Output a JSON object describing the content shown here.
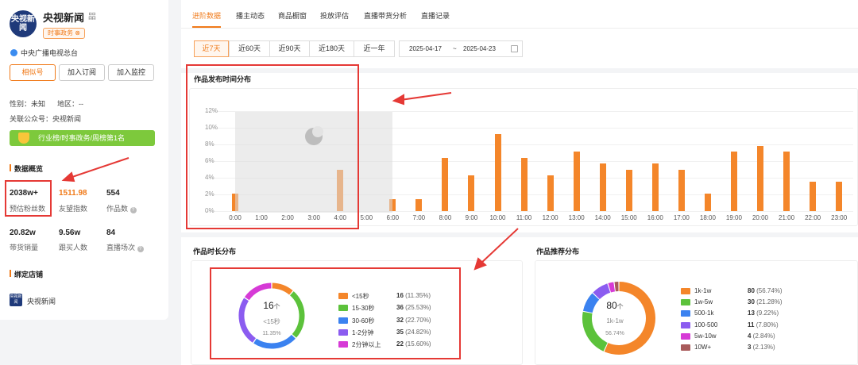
{
  "account": {
    "avatar_text": "央视新闻",
    "name": "央视新闻",
    "flag": "㗊",
    "tag": "时事政务 ⊗",
    "verified": "中央广播电视总台",
    "buttons": [
      "相似号",
      "加入订阅",
      "加入监控"
    ],
    "gender": "性别：未知",
    "region": "地区：--",
    "official": "关联公众号：央视新闻",
    "rank": "行业榜/时事政务/周榜第1名"
  },
  "overview": {
    "title": "数据概览",
    "stats": [
      {
        "value": "2038w+",
        "label": "预估粉丝数"
      },
      {
        "value": "1511.98",
        "label": "友望指数"
      },
      {
        "value": "554",
        "label": "作品数"
      },
      {
        "value": "20.82w",
        "label": "带货销量"
      },
      {
        "value": "9.56w",
        "label": "跟买人数"
      },
      {
        "value": "84",
        "label": "直播场次"
      }
    ]
  },
  "shop": {
    "title": "绑定店铺",
    "logo": "央视新闻",
    "name": "央视新闻"
  },
  "tabs": [
    "进阶数据",
    "播主动态",
    "商品橱窗",
    "投放评估",
    "直播带货分析",
    "直播记录"
  ],
  "ranges": [
    "近7天",
    "近60天",
    "近90天",
    "近180天",
    "近一年"
  ],
  "date_range": {
    "start": "2025-04-17",
    "sep": "~",
    "end": "2025-04-23"
  },
  "time_chart": {
    "title": "作品发布时间分布",
    "y_ticks": [
      "12%",
      "10%",
      "8%",
      "6%",
      "4%",
      "2%",
      "0%"
    ]
  },
  "duration_chart": {
    "title": "作品时长分布",
    "center_value": "16",
    "center_unit": "个",
    "center_label": "<15秒",
    "center_pct": "11.35%",
    "legend": [
      {
        "label": "<15秒",
        "count": "16",
        "pct": "(11.35%)",
        "color": "#f4862a"
      },
      {
        "label": "15-30秒",
        "count": "36",
        "pct": "(25.53%)",
        "color": "#5cc23b"
      },
      {
        "label": "30-60秒",
        "count": "32",
        "pct": "(22.70%)",
        "color": "#3b82f0"
      },
      {
        "label": "1-2分钟",
        "count": "35",
        "pct": "(24.82%)",
        "color": "#8b5cf0"
      },
      {
        "label": "2分钟以上",
        "count": "22",
        "pct": "(15.60%)",
        "color": "#d63ad6"
      }
    ]
  },
  "recommend_chart": {
    "title": "作品推荐分布",
    "center_value": "80",
    "center_unit": "个",
    "center_label": "1k-1w",
    "center_pct": "56.74%",
    "legend": [
      {
        "label": "1k-1w",
        "count": "80",
        "pct": "(56.74%)",
        "color": "#f4862a"
      },
      {
        "label": "1w-5w",
        "count": "30",
        "pct": "(21.28%)",
        "color": "#5cc23b"
      },
      {
        "label": "500-1k",
        "count": "13",
        "pct": "(9.22%)",
        "color": "#3b82f0"
      },
      {
        "label": "100-500",
        "count": "11",
        "pct": "(7.80%)",
        "color": "#8b5cf0"
      },
      {
        "label": "5w-10w",
        "count": "4",
        "pct": "(2.84%)",
        "color": "#d63ad6"
      },
      {
        "label": "10W+",
        "count": "3",
        "pct": "(2.13%)",
        "color": "#a85a5a"
      }
    ]
  },
  "chart_data": [
    {
      "type": "bar",
      "title": "作品发布时间分布",
      "categories": [
        "0:00",
        "1:00",
        "2:00",
        "3:00",
        "4:00",
        "5:00",
        "6:00",
        "7:00",
        "8:00",
        "9:00",
        "10:00",
        "11:00",
        "12:00",
        "13:00",
        "14:00",
        "15:00",
        "16:00",
        "17:00",
        "18:00",
        "19:00",
        "20:00",
        "21:00",
        "22:00",
        "23:00"
      ],
      "values": [
        2.1,
        0,
        0,
        0,
        5.0,
        0,
        1.4,
        1.4,
        6.4,
        4.3,
        9.2,
        6.4,
        4.3,
        7.1,
        5.7,
        5.0,
        5.7,
        5.0,
        2.1,
        7.1,
        7.8,
        7.1,
        3.5,
        3.5
      ],
      "ylim": [
        0,
        12
      ],
      "grid": true
    },
    {
      "type": "pie",
      "title": "作品时长分布",
      "categories": [
        "<15秒",
        "15-30秒",
        "30-60秒",
        "1-2分钟",
        "2分钟以上"
      ],
      "values": [
        16,
        36,
        32,
        35,
        22
      ]
    },
    {
      "type": "pie",
      "title": "作品推荐分布",
      "categories": [
        "1k-1w",
        "1w-5w",
        "500-1k",
        "100-500",
        "5w-10w",
        "10W+"
      ],
      "values": [
        80,
        30,
        13,
        11,
        4,
        3
      ]
    }
  ]
}
